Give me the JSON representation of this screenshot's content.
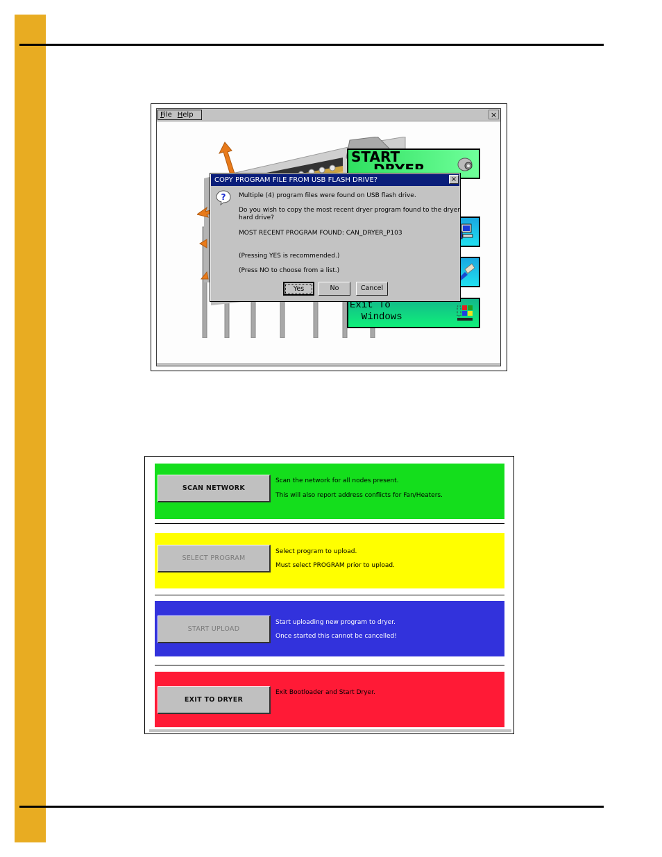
{
  "page": {
    "accent_color": "#E8AC22"
  },
  "figure1": {
    "menu": [
      {
        "label": "File",
        "accesskey": "F"
      },
      {
        "label": "Help",
        "accesskey": "H"
      }
    ],
    "window_close": "×",
    "side_buttons": {
      "start_line1": "START",
      "start_line2": "DRYER",
      "exit_line1": "Exit To",
      "exit_line2": "  Windows"
    },
    "dialog": {
      "title": "COPY PROGRAM FILE FROM USB FLASH DRIVE?",
      "close": "×",
      "lines": [
        "Multiple (4) program files were found on USB flash drive.",
        "Do you wish to copy the most recent dryer program found to the dryer",
        "hard drive?",
        "MOST RECENT PROGRAM FOUND: CAN_DRYER_P103",
        "(Pressing YES is recommended.)",
        "(Press NO to choose from a list.)"
      ],
      "buttons": {
        "yes": "Yes",
        "no": "No",
        "cancel": "Cancel"
      }
    }
  },
  "figure2": {
    "panels": [
      {
        "color": "#14DE1C",
        "button": "SCAN NETWORK",
        "enabled": true,
        "desc": [
          "Scan the network for all nodes present.",
          "This will also report address conflicts for Fan/Heaters."
        ]
      },
      {
        "color": "#FFFF00",
        "button": "SELECT PROGRAM",
        "enabled": false,
        "desc": [
          "Select program to upload.",
          "Must select PROGRAM prior to upload."
        ]
      },
      {
        "color": "#3232DC",
        "button": "START UPLOAD",
        "enabled": false,
        "desc": [
          "Start uploading new program to dryer.",
          "Once started this cannot be cancelled!"
        ]
      },
      {
        "color": "#FF1A36",
        "button": "EXIT TO DRYER",
        "enabled": true,
        "desc": [
          "Exit Bootloader and Start Dryer."
        ]
      }
    ]
  }
}
